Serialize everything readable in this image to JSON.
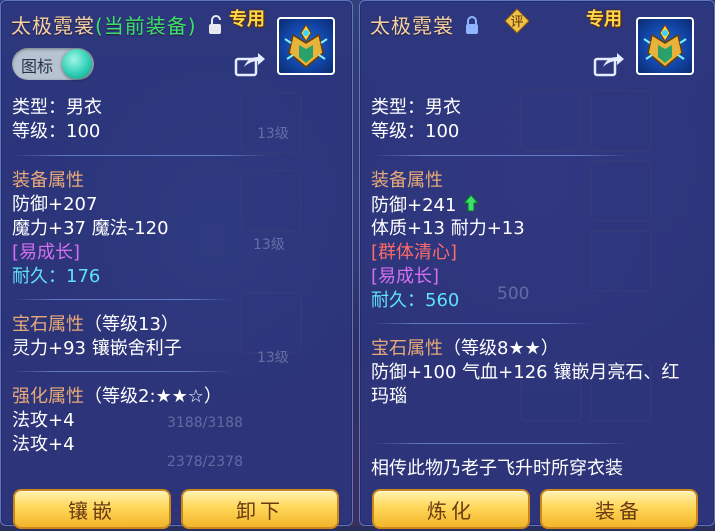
{
  "left": {
    "title": "太极霓裳",
    "title_tag": "(当前装备)",
    "special_label": "专用",
    "toggle_label": "图标",
    "type_line": "类型：男衣",
    "level_line": "等级：100",
    "equip_header": "装备属性",
    "stats": [
      "防御+207",
      "魔力+37 魔法-120"
    ],
    "trait": "[易成长]",
    "durability_label": "耐久：",
    "durability_value": "176",
    "gem_header": "宝石属性",
    "gem_level": "（等级13）",
    "gem_line": "灵力+93 镶嵌舍利子",
    "enhance_header": "强化属性",
    "enhance_level": "（等级2:★★☆）",
    "enhance_lines": [
      "法攻+4",
      "法攻+4"
    ],
    "buttons": [
      "镶嵌",
      "卸下"
    ]
  },
  "right": {
    "title": "太极霓裳",
    "review_label": "评",
    "special_label": "专用",
    "type_line": "类型：男衣",
    "level_line": "等级：100",
    "equip_header": "装备属性",
    "stat_defense": "防御+241",
    "stat_line2": "体质+13 耐力+13",
    "trait_red": "[群体清心]",
    "trait_purple": "[易成长]",
    "durability_label": "耐久：",
    "durability_value": "560",
    "gem_header": "宝石属性",
    "gem_level": "（等级8★★）",
    "gem_line1": "防御+100 气血+126 镶嵌月亮石、红",
    "gem_line2": "玛瑙",
    "description": "相传此物乃老子飞升时所穿衣装",
    "buttons": [
      "炼化",
      "装备"
    ]
  },
  "background": {
    "bar1": "3188/3188",
    "bar2": "2378/2378",
    "num_500": "500",
    "label_13a": "13级",
    "label_13b": "13级",
    "label_13c": "13级"
  },
  "colors": {
    "panel_bg": "#2c367e",
    "header": "#e8a978",
    "title": "#f3d2a0",
    "current_tag": "#3be06a",
    "durability": "#5fe3f5",
    "trait_purple": "#d66ef0",
    "trait_red": "#ff6a6a",
    "special": "#ffd84a",
    "button_gold": "#ffd75a"
  },
  "icons": [
    "unlock-icon",
    "lock-icon",
    "share-icon",
    "armor-icon",
    "up-arrow-icon",
    "review-badge"
  ]
}
